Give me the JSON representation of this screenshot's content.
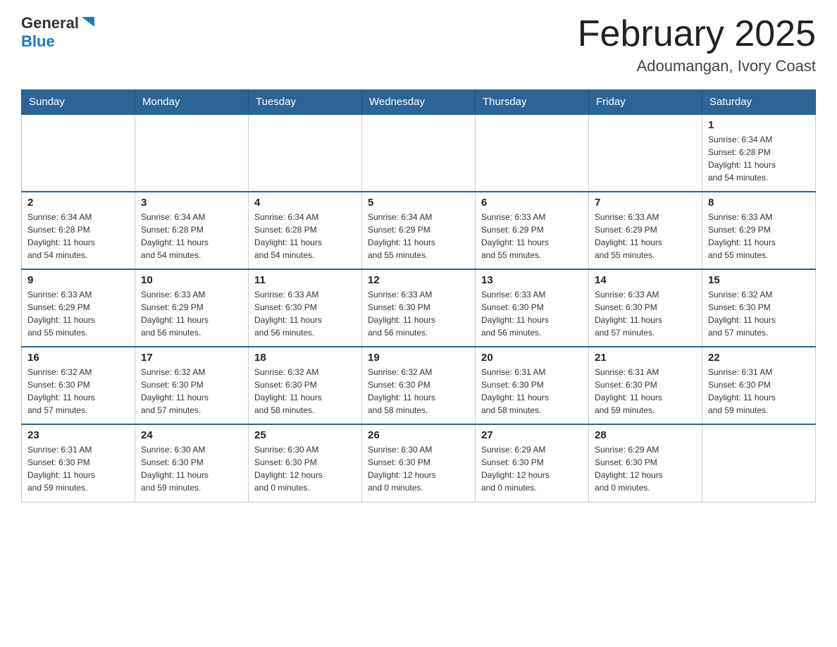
{
  "header": {
    "logo_general": "General",
    "logo_blue": "Blue",
    "title": "February 2025",
    "subtitle": "Adoumangan, Ivory Coast"
  },
  "weekdays": [
    "Sunday",
    "Monday",
    "Tuesday",
    "Wednesday",
    "Thursday",
    "Friday",
    "Saturday"
  ],
  "weeks": [
    [
      {
        "day": "",
        "info": ""
      },
      {
        "day": "",
        "info": ""
      },
      {
        "day": "",
        "info": ""
      },
      {
        "day": "",
        "info": ""
      },
      {
        "day": "",
        "info": ""
      },
      {
        "day": "",
        "info": ""
      },
      {
        "day": "1",
        "info": "Sunrise: 6:34 AM\nSunset: 6:28 PM\nDaylight: 11 hours\nand 54 minutes."
      }
    ],
    [
      {
        "day": "2",
        "info": "Sunrise: 6:34 AM\nSunset: 6:28 PM\nDaylight: 11 hours\nand 54 minutes."
      },
      {
        "day": "3",
        "info": "Sunrise: 6:34 AM\nSunset: 6:28 PM\nDaylight: 11 hours\nand 54 minutes."
      },
      {
        "day": "4",
        "info": "Sunrise: 6:34 AM\nSunset: 6:28 PM\nDaylight: 11 hours\nand 54 minutes."
      },
      {
        "day": "5",
        "info": "Sunrise: 6:34 AM\nSunset: 6:29 PM\nDaylight: 11 hours\nand 55 minutes."
      },
      {
        "day": "6",
        "info": "Sunrise: 6:33 AM\nSunset: 6:29 PM\nDaylight: 11 hours\nand 55 minutes."
      },
      {
        "day": "7",
        "info": "Sunrise: 6:33 AM\nSunset: 6:29 PM\nDaylight: 11 hours\nand 55 minutes."
      },
      {
        "day": "8",
        "info": "Sunrise: 6:33 AM\nSunset: 6:29 PM\nDaylight: 11 hours\nand 55 minutes."
      }
    ],
    [
      {
        "day": "9",
        "info": "Sunrise: 6:33 AM\nSunset: 6:29 PM\nDaylight: 11 hours\nand 55 minutes."
      },
      {
        "day": "10",
        "info": "Sunrise: 6:33 AM\nSunset: 6:29 PM\nDaylight: 11 hours\nand 56 minutes."
      },
      {
        "day": "11",
        "info": "Sunrise: 6:33 AM\nSunset: 6:30 PM\nDaylight: 11 hours\nand 56 minutes."
      },
      {
        "day": "12",
        "info": "Sunrise: 6:33 AM\nSunset: 6:30 PM\nDaylight: 11 hours\nand 56 minutes."
      },
      {
        "day": "13",
        "info": "Sunrise: 6:33 AM\nSunset: 6:30 PM\nDaylight: 11 hours\nand 56 minutes."
      },
      {
        "day": "14",
        "info": "Sunrise: 6:33 AM\nSunset: 6:30 PM\nDaylight: 11 hours\nand 57 minutes."
      },
      {
        "day": "15",
        "info": "Sunrise: 6:32 AM\nSunset: 6:30 PM\nDaylight: 11 hours\nand 57 minutes."
      }
    ],
    [
      {
        "day": "16",
        "info": "Sunrise: 6:32 AM\nSunset: 6:30 PM\nDaylight: 11 hours\nand 57 minutes."
      },
      {
        "day": "17",
        "info": "Sunrise: 6:32 AM\nSunset: 6:30 PM\nDaylight: 11 hours\nand 57 minutes."
      },
      {
        "day": "18",
        "info": "Sunrise: 6:32 AM\nSunset: 6:30 PM\nDaylight: 11 hours\nand 58 minutes."
      },
      {
        "day": "19",
        "info": "Sunrise: 6:32 AM\nSunset: 6:30 PM\nDaylight: 11 hours\nand 58 minutes."
      },
      {
        "day": "20",
        "info": "Sunrise: 6:31 AM\nSunset: 6:30 PM\nDaylight: 11 hours\nand 58 minutes."
      },
      {
        "day": "21",
        "info": "Sunrise: 6:31 AM\nSunset: 6:30 PM\nDaylight: 11 hours\nand 59 minutes."
      },
      {
        "day": "22",
        "info": "Sunrise: 6:31 AM\nSunset: 6:30 PM\nDaylight: 11 hours\nand 59 minutes."
      }
    ],
    [
      {
        "day": "23",
        "info": "Sunrise: 6:31 AM\nSunset: 6:30 PM\nDaylight: 11 hours\nand 59 minutes."
      },
      {
        "day": "24",
        "info": "Sunrise: 6:30 AM\nSunset: 6:30 PM\nDaylight: 11 hours\nand 59 minutes."
      },
      {
        "day": "25",
        "info": "Sunrise: 6:30 AM\nSunset: 6:30 PM\nDaylight: 12 hours\nand 0 minutes."
      },
      {
        "day": "26",
        "info": "Sunrise: 6:30 AM\nSunset: 6:30 PM\nDaylight: 12 hours\nand 0 minutes."
      },
      {
        "day": "27",
        "info": "Sunrise: 6:29 AM\nSunset: 6:30 PM\nDaylight: 12 hours\nand 0 minutes."
      },
      {
        "day": "28",
        "info": "Sunrise: 6:29 AM\nSunset: 6:30 PM\nDaylight: 12 hours\nand 0 minutes."
      },
      {
        "day": "",
        "info": ""
      }
    ]
  ]
}
